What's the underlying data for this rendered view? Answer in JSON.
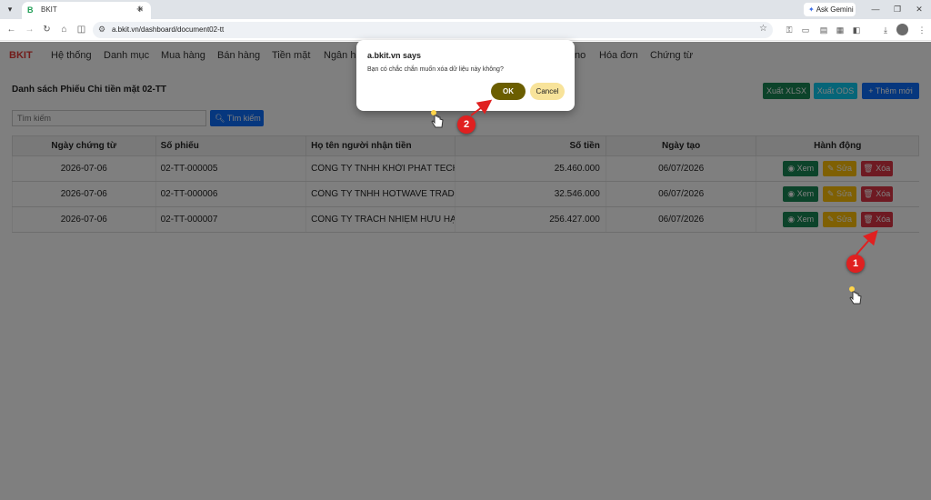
{
  "browser": {
    "tab_title": "BKIT",
    "tab_favicon": "B",
    "gemini_label": "Ask Gemini",
    "url": "a.bkit.vn/dashboard/document02-tt"
  },
  "nav": {
    "brand": "BKIT",
    "items": [
      "Hệ thống",
      "Danh mục",
      "Mua hàng",
      "Bán hàng",
      "Tiền mặt",
      "Ngân hà",
      "no",
      "Hóa đơn",
      "Chứng từ"
    ]
  },
  "page": {
    "title": "Danh sách Phiếu Chi tiền mặt 02-TT",
    "btn_xlsx": "Xuất XLSX",
    "btn_ods": "Xuất ODS",
    "btn_add": "+ Thêm mới",
    "search_placeholder": "Tìm kiếm",
    "search_btn": "Tìm kiếm"
  },
  "table": {
    "headers": [
      "Ngày chứng từ",
      "Số phiếu",
      "Họ tên người nhận tiền",
      "Số tiền",
      "Ngày tạo",
      "Hành động"
    ],
    "rows": [
      [
        "2026-07-06",
        "02-TT-000005",
        "CÔNG TY TNHH KHỞI PHÁT TECHN",
        "25.460.000",
        "06/07/2026"
      ],
      [
        "2026-07-06",
        "02-TT-000006",
        "CÔNG TY TNHH HOTWAVE TRADE",
        "32.546.000",
        "06/07/2026"
      ],
      [
        "2026-07-06",
        "02-TT-000007",
        "CÔNG TY TRÁCH NHIỆM HỮU HẠN",
        "256.427.000",
        "06/07/2026"
      ]
    ],
    "action_view": "Xem",
    "action_edit": "Sửa",
    "action_delete": "Xóa"
  },
  "dialog": {
    "title": "a.bkit.vn says",
    "message": "Bạn có chắc chắn muốn xóa dữ liệu này không?",
    "ok": "OK",
    "cancel": "Cancel"
  },
  "annotations": {
    "marker_1": "1",
    "marker_2": "2",
    "color": "#e02020"
  },
  "colors": {
    "brand": "#e53935",
    "success": "#198754",
    "info": "#0dcaf0",
    "primary": "#0d6efd",
    "warning": "#ffc107",
    "danger": "#dc3545"
  }
}
